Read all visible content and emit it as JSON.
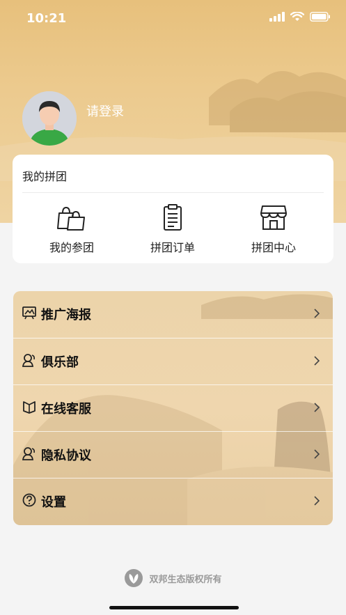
{
  "status_bar": {
    "time": "10:21"
  },
  "profile": {
    "login_text": "请登录"
  },
  "group": {
    "title": "我的拼团",
    "items": [
      {
        "label": "我的参团",
        "icon": "shopping-bags-icon"
      },
      {
        "label": "拼团订单",
        "icon": "clipboard-icon"
      },
      {
        "label": "拼团中心",
        "icon": "store-icon"
      }
    ]
  },
  "menu": {
    "items": [
      {
        "label": "推广海报",
        "icon": "poster-icon"
      },
      {
        "label": "俱乐部",
        "icon": "club-icon"
      },
      {
        "label": "在线客服",
        "icon": "customer-service-icon"
      },
      {
        "label": "隐私协议",
        "icon": "privacy-icon"
      },
      {
        "label": "设置",
        "icon": "help-circle-icon"
      }
    ]
  },
  "footer": {
    "copyright": "双邦生态版权所有"
  },
  "colors": {
    "header_gold": "#e7c07c",
    "menu_bg": "#ecd4aa",
    "page_bg": "#f4f4f4"
  }
}
